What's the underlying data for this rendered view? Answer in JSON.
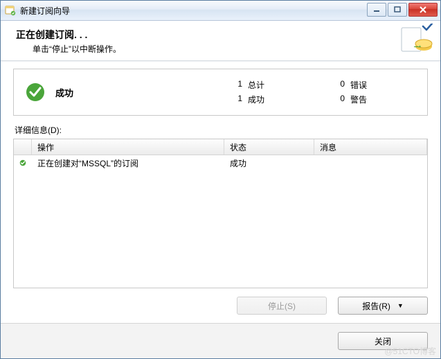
{
  "window": {
    "title": "新建订阅向导"
  },
  "header": {
    "title": "正在创建订阅. . .",
    "subtitle": "单击“停止”以中断操作。"
  },
  "summary": {
    "status_label": "成功",
    "stats": {
      "total_n": "1",
      "total_label": "总计",
      "success_n": "1",
      "success_label": "成功",
      "error_n": "0",
      "error_label": "错误",
      "warn_n": "0",
      "warn_label": "警告"
    }
  },
  "details": {
    "label": "详细信息(D):",
    "columns": {
      "op": "操作",
      "status": "状态",
      "msg": "消息"
    },
    "rows": [
      {
        "op": "正在创建对“MSSQL”的订阅",
        "status": "成功",
        "msg": ""
      }
    ]
  },
  "buttons": {
    "stop": "停止(S)",
    "report": "报告(R)",
    "close": "关闭"
  },
  "watermark": "@51CTO博客"
}
